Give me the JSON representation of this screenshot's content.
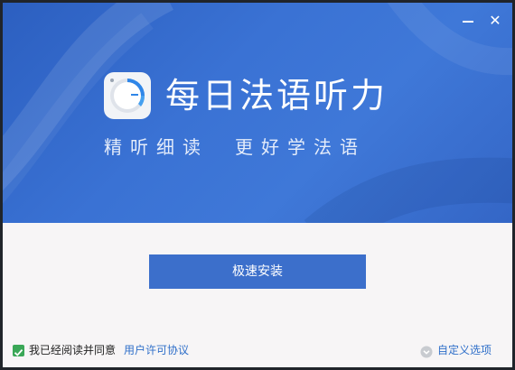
{
  "window": {
    "minimize_icon": "minimize-icon",
    "close_icon": "close-icon",
    "close_glyph": "✕"
  },
  "hero": {
    "title": "每日法语听力",
    "slogan": "精听细读　更好学法语",
    "app_icon": "app-logo-icon"
  },
  "install": {
    "label": "极速安装"
  },
  "footer": {
    "agree_checked": true,
    "agree_text": "我已经阅读并同意",
    "license_link": "用户许可协议",
    "custom_text": "自定义选项"
  },
  "colors": {
    "hero_blue": "#3a72d4",
    "button_blue": "#3c6fcb",
    "link_blue": "#2f6fc9",
    "check_green": "#3aa757"
  }
}
